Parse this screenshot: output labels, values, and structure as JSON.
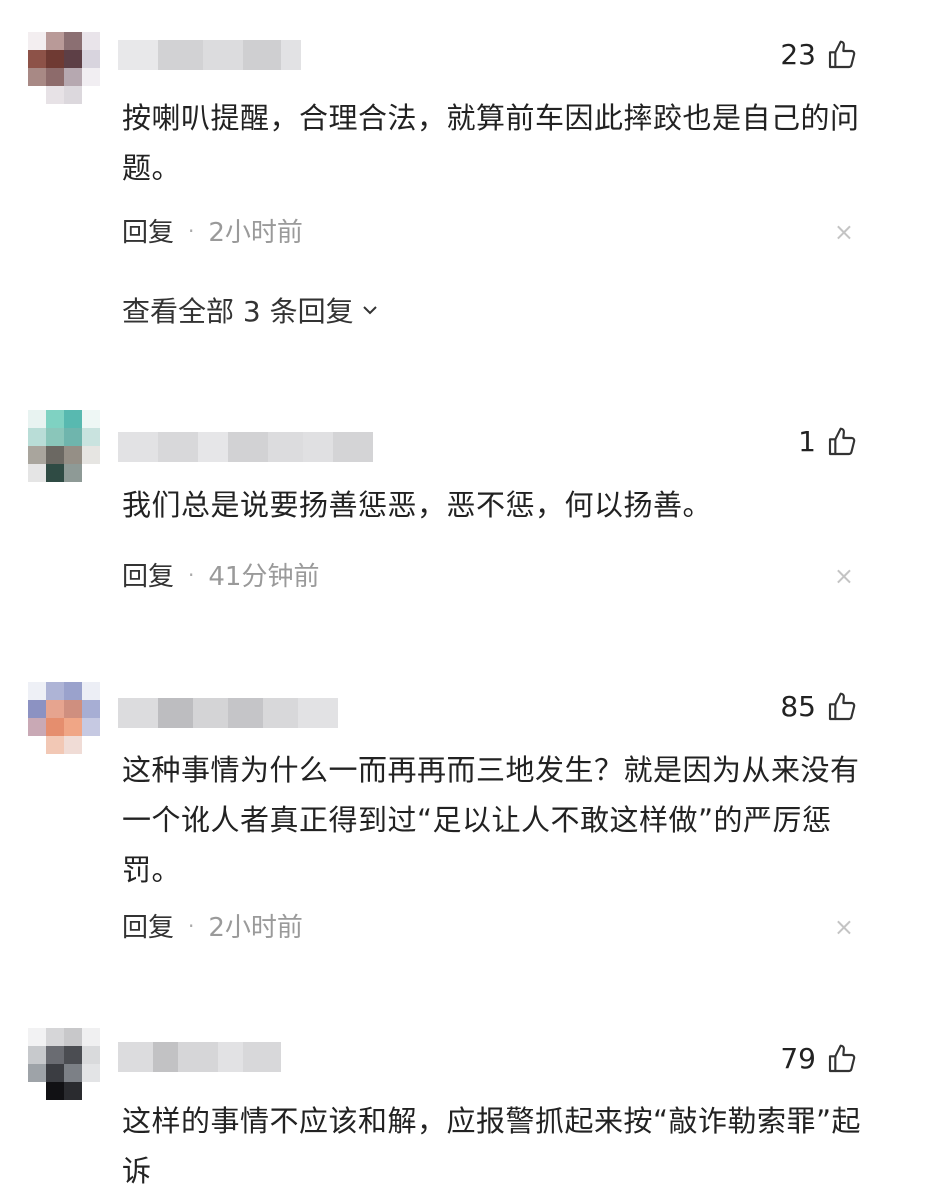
{
  "comments": [
    {
      "likes": "23",
      "text": "按喇叭提醒，合理合法，就算前车因此摔跤也是自己的问题。",
      "reply_label": "回复",
      "separator": "·",
      "time": "2小时前",
      "close_symbol": "×",
      "view_all": "查看全部 3 条回复"
    },
    {
      "likes": "1",
      "text": "我们总是说要扬善惩恶，恶不惩，何以扬善。",
      "reply_label": "回复",
      "separator": "·",
      "time": "41分钟前",
      "close_symbol": "×"
    },
    {
      "likes": "85",
      "text": "这种事情为什么一而再再而三地发生？就是因为从来没有一个讹人者真正得到过“足以让人不敢这样做”的严厉惩罚。",
      "reply_label": "回复",
      "separator": "·",
      "time": "2小时前",
      "close_symbol": "×"
    },
    {
      "likes": "79",
      "text": "这样的事情不应该和解，应报警抓起来按“敲诈勒索罪”起诉"
    }
  ],
  "icons": {
    "like": "thumbs-up-icon",
    "close": "close-icon",
    "chevron": "chevron-down-icon"
  },
  "colors": {
    "text": "#222222",
    "meta": "#9a9a9a",
    "close": "#c4c4c4"
  }
}
